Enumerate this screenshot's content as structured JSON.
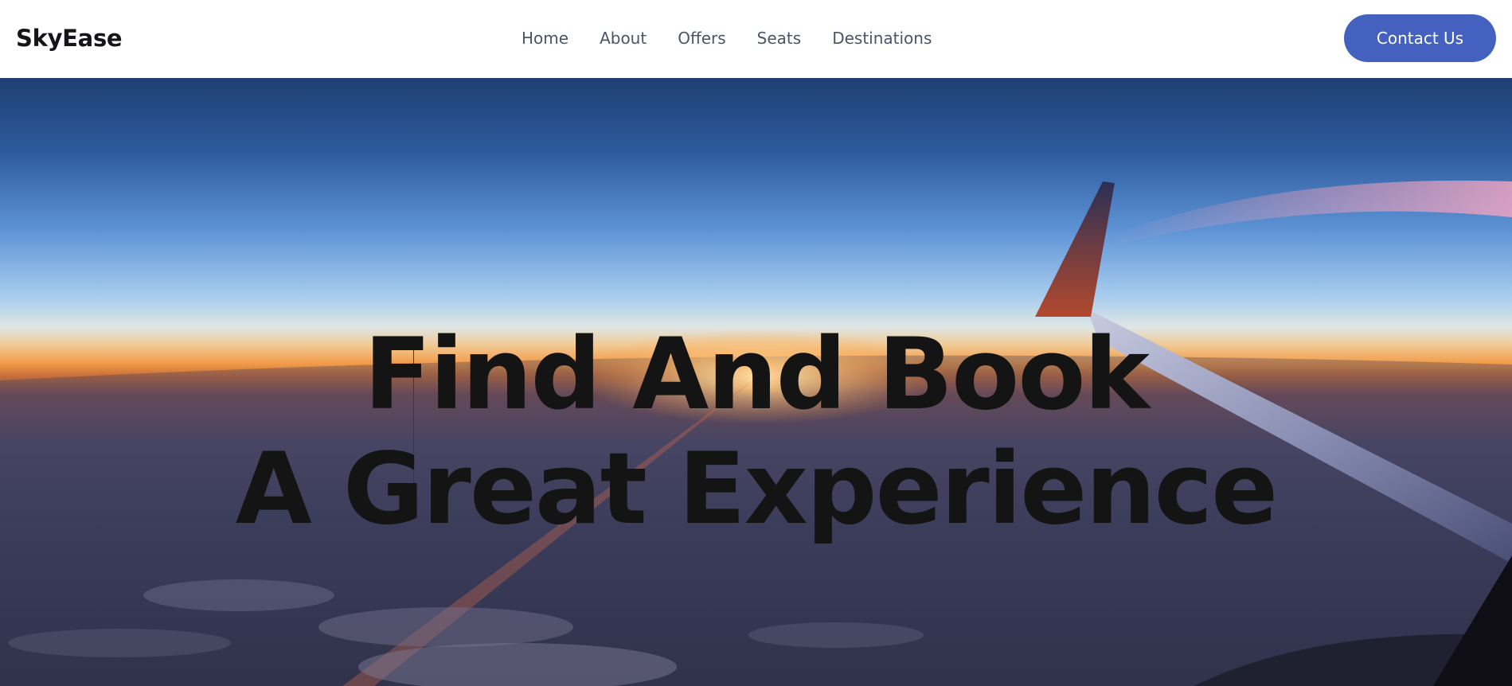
{
  "brand": {
    "name": "SkyEase"
  },
  "nav": {
    "items": [
      {
        "label": "Home"
      },
      {
        "label": "About"
      },
      {
        "label": "Offers"
      },
      {
        "label": "Seats"
      },
      {
        "label": "Destinations"
      }
    ]
  },
  "cta": {
    "label": "Contact Us"
  },
  "hero": {
    "headline_line1": "Find And Book",
    "headline_line2": "A Great Experience",
    "background": "airplane-wing-sunset-photo"
  },
  "colors": {
    "accent": "#4461bf",
    "nav_text": "#4b5563",
    "brand_text": "#14151a",
    "headline_text": "#141414"
  }
}
